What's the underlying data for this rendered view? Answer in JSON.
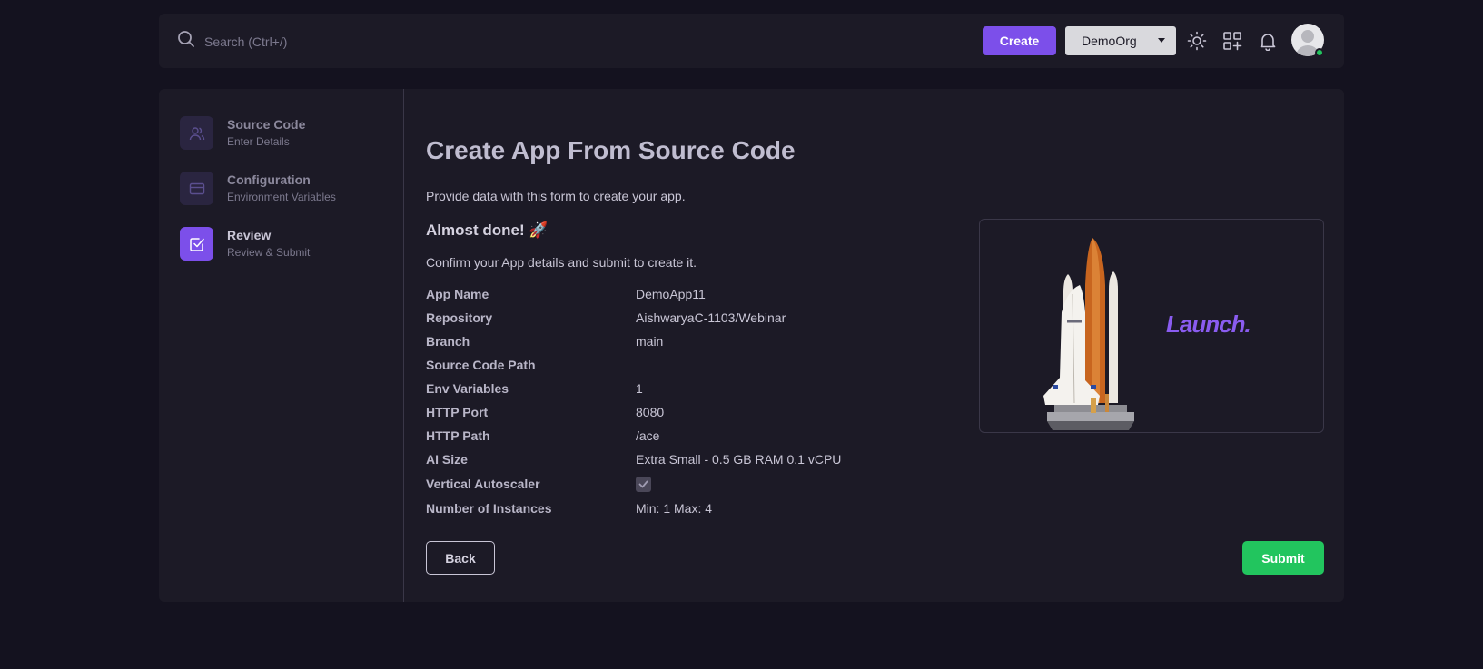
{
  "topbar": {
    "search_placeholder": "Search (Ctrl+/)",
    "create_label": "Create",
    "org_name": "DemoOrg",
    "icons": [
      "search-icon",
      "sun-icon",
      "apps-add-icon",
      "bell-icon",
      "avatar"
    ]
  },
  "stepper": {
    "steps": [
      {
        "title": "Source Code",
        "subtitle": "Enter Details",
        "icon": "users-icon",
        "active": false
      },
      {
        "title": "Configuration",
        "subtitle": "Environment Variables",
        "icon": "card-icon",
        "active": false
      },
      {
        "title": "Review",
        "subtitle": "Review & Submit",
        "icon": "checkbox-icon",
        "active": true
      }
    ]
  },
  "main": {
    "title": "Create App From Source Code",
    "description": "Provide data with this form to create your app.",
    "almost_done": "Almost done! 🚀",
    "confirm_text": "Confirm your App details and submit to create it.",
    "details": [
      {
        "label": "App Name",
        "value": "DemoApp11"
      },
      {
        "label": "Repository",
        "value": "AishwaryaC-1103/Webinar"
      },
      {
        "label": "Branch",
        "value": "main"
      },
      {
        "label": "Source Code Path",
        "value": ""
      },
      {
        "label": "Env Variables",
        "value": "1"
      },
      {
        "label": "HTTP Port",
        "value": "8080"
      },
      {
        "label": "HTTP Path",
        "value": "/ace"
      },
      {
        "label": "AI Size",
        "value": "Extra Small - 0.5 GB RAM 0.1 vCPU"
      },
      {
        "label": "Vertical Autoscaler",
        "value": ""
      },
      {
        "label": "Number of Instances",
        "value": "Min: 1 Max: 4"
      }
    ],
    "vertical_autoscaler_checked": true,
    "illustration_text": "Launch.",
    "back_label": "Back",
    "submit_label": "Submit"
  },
  "colors": {
    "background": "#14121f",
    "surface": "#1c1a26",
    "accent": "#7c4fea",
    "success": "#22c55e"
  }
}
